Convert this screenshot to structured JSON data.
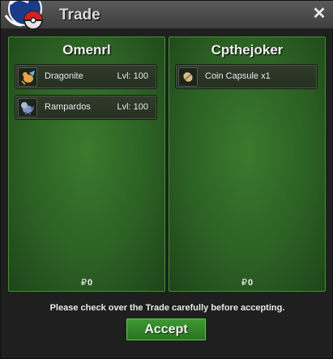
{
  "window": {
    "title": "Trade",
    "close_glyph": "✕"
  },
  "left_panel": {
    "player_name": "Omenrl",
    "items": [
      {
        "name": "Dragonite",
        "level": "Lvl: 100",
        "icon": "dragonite-sprite-icon"
      },
      {
        "name": "Rampardos",
        "level": "Lvl: 100",
        "icon": "rampardos-sprite-icon"
      }
    ],
    "money_symbol": "₽",
    "money": "0"
  },
  "right_panel": {
    "player_name": "Cpthejoker",
    "items": [
      {
        "name": "Coin Capsule",
        "quantity": "x1",
        "icon": "coin-capsule-icon"
      }
    ],
    "money_symbol": "₽",
    "money": "0"
  },
  "footer": {
    "notice": "Please check over the Trade carefully before accepting.",
    "accept_label": "Accept"
  },
  "colors": {
    "panel_green": "#2c6124",
    "accept_green": "#3f9a32",
    "titlebar": "#4a4a4a"
  }
}
